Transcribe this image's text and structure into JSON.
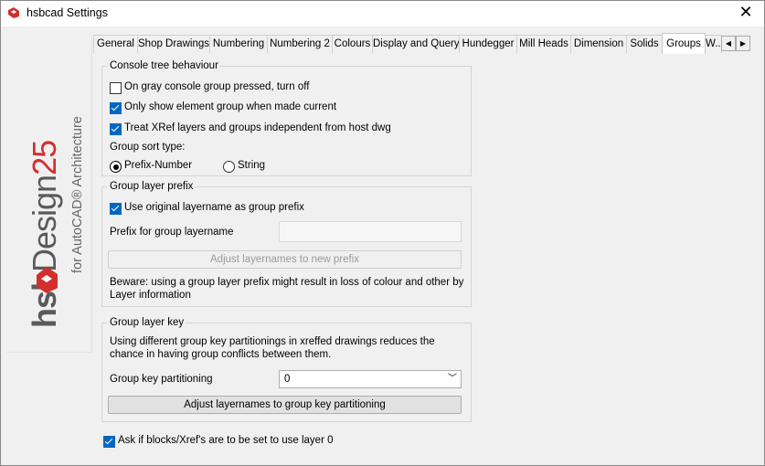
{
  "window": {
    "title": "hsbcad Settings",
    "close_glyph": "✕"
  },
  "logo": {
    "brand": "hsbDesign 25",
    "subtitle": "for AutoCAD® Architecture"
  },
  "tabs": [
    "General",
    "Shop Drawings",
    "Numbering",
    "Numbering 2",
    "Colours",
    "Display and Query",
    "Hundegger",
    "Mill Heads",
    "Dimension",
    "Solids",
    "Groups",
    "W..."
  ],
  "active_tab": "Groups",
  "console_tree": {
    "legend": "Console tree behaviour",
    "gray_group_off": {
      "label": "On gray console group pressed, turn off",
      "checked": false
    },
    "only_show_element": {
      "label": "Only show element group when made current",
      "checked": true
    },
    "treat_xref": {
      "label": "Treat XRef layers and groups independent from host dwg",
      "checked": true
    },
    "sort_type_label": "Group sort type:",
    "sort_prefix_number": {
      "label": "Prefix-Number",
      "selected": true
    },
    "sort_string": {
      "label": "String",
      "selected": false
    }
  },
  "layer_prefix": {
    "legend": "Group layer prefix",
    "use_original": {
      "label": "Use original layername as group prefix",
      "checked": true
    },
    "prefix_label": "Prefix for group layername",
    "prefix_value": "",
    "adjust_button": "Adjust layernames to new prefix",
    "warning": "Beware: using a group layer prefix might result in loss of colour and other by Layer information"
  },
  "layer_key": {
    "legend": "Group layer key",
    "description": "Using different group key partitionings in xreffed drawings reduces the chance in having group conflicts between them.",
    "partition_label": "Group key partitioning",
    "partition_value": "0",
    "adjust_button": "Adjust layernames to group key partitioning"
  },
  "ask_blocks": {
    "label": "Ask if blocks/Xref's are to be set to use layer 0",
    "checked": true
  },
  "colors": {
    "accent": "#0067c0",
    "logo_red": "#d32f2f",
    "logo_gray": "#5a5a5a"
  }
}
